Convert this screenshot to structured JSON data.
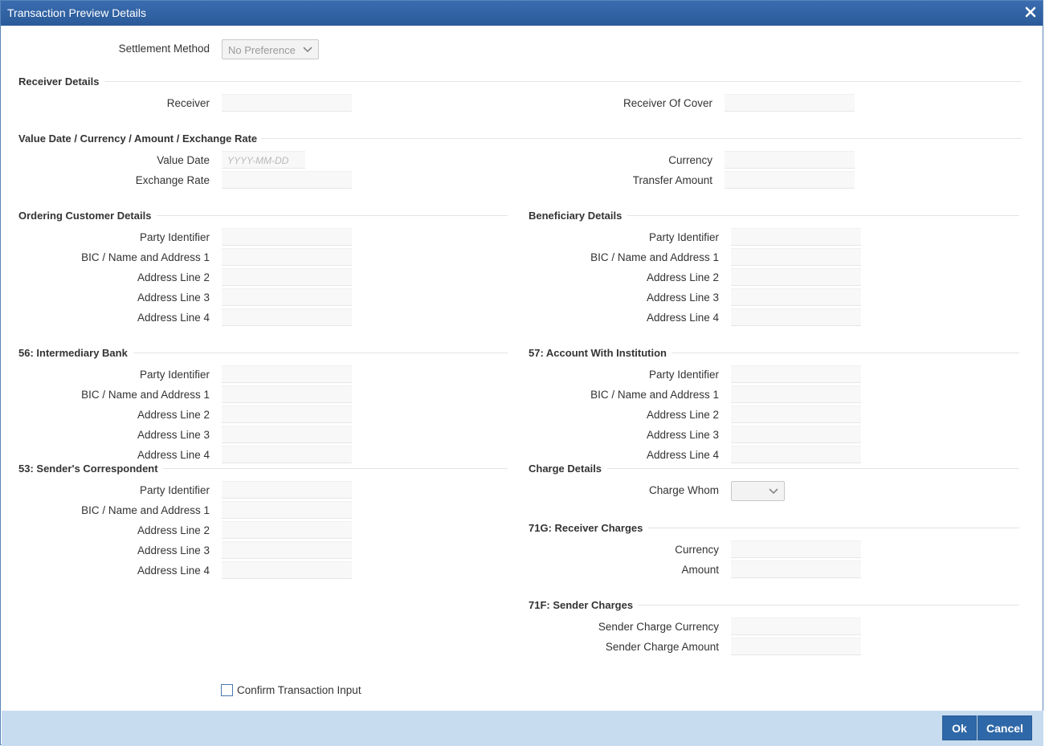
{
  "window": {
    "title": "Transaction Preview Details",
    "close_icon": "close-icon"
  },
  "settlement": {
    "label": "Settlement Method",
    "value": "No Preference"
  },
  "receiver_details": {
    "heading": "Receiver Details",
    "receiver_label": "Receiver",
    "receiver_value": "",
    "cover_label": "Receiver Of Cover",
    "cover_value": ""
  },
  "value_date_section": {
    "heading": "Value Date / Currency / Amount / Exchange Rate",
    "value_date_label": "Value Date",
    "value_date_placeholder": "YYYY-MM-DD",
    "exchange_rate_label": "Exchange Rate",
    "currency_label": "Currency",
    "transfer_amount_label": "Transfer Amount"
  },
  "ordering_customer": {
    "heading": "Ordering Customer Details",
    "labels": [
      "Party Identifier",
      "BIC / Name and Address 1",
      "Address Line 2",
      "Address Line 3",
      "Address Line 4"
    ]
  },
  "beneficiary": {
    "heading": "Beneficiary Details",
    "labels": [
      "Party Identifier",
      "BIC / Name and Address 1",
      "Address Line 2",
      "Address Line 3",
      "Address Line 4"
    ]
  },
  "intermediary": {
    "heading": "56: Intermediary Bank",
    "labels": [
      "Party Identifier",
      "BIC / Name and Address 1",
      "Address Line 2",
      "Address Line 3",
      "Address Line 4"
    ]
  },
  "account_with": {
    "heading": "57: Account With Institution",
    "labels": [
      "Party Identifier",
      "BIC / Name and Address 1",
      "Address Line 2",
      "Address Line 3",
      "Address Line 4"
    ]
  },
  "senders_correspondent": {
    "heading": "53: Sender's Correspondent",
    "labels": [
      "Party Identifier",
      "BIC / Name and Address 1",
      "Address Line 2",
      "Address Line 3",
      "Address Line 4"
    ]
  },
  "charge_details": {
    "heading": "Charge Details",
    "charge_whom_label": "Charge Whom",
    "charge_whom_value": ""
  },
  "receiver_charges": {
    "heading": "71G: Receiver Charges",
    "currency_label": "Currency",
    "amount_label": "Amount"
  },
  "sender_charges": {
    "heading": "71F: Sender Charges",
    "currency_label": "Sender Charge Currency",
    "amount_label": "Sender Charge Amount"
  },
  "confirm": {
    "label": "Confirm Transaction Input",
    "checked": false
  },
  "footer": {
    "ok_label": "Ok",
    "cancel_label": "Cancel"
  }
}
